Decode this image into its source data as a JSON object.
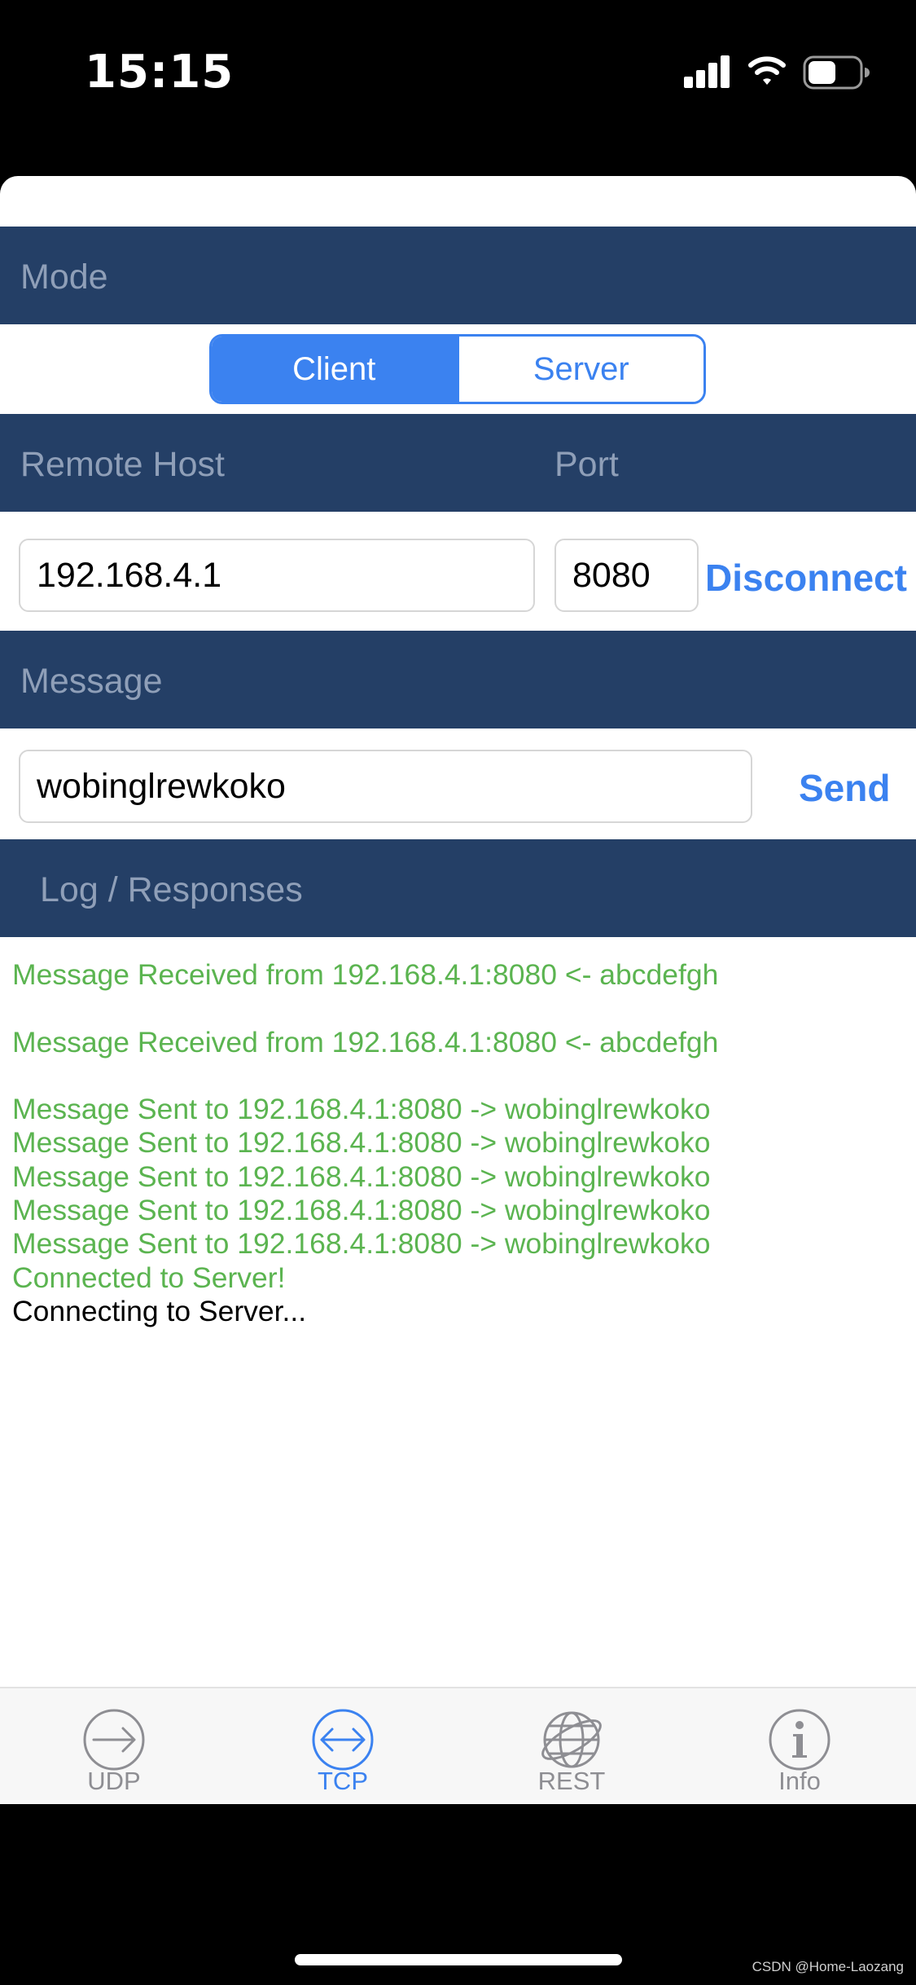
{
  "status_bar": {
    "time": "15:15",
    "battery_level": 0.55
  },
  "mode": {
    "header": "Mode",
    "segments": [
      {
        "label": "Client",
        "selected": true
      },
      {
        "label": "Server",
        "selected": false
      }
    ]
  },
  "connection": {
    "host_header": "Remote Host",
    "port_header": "Port",
    "host_value": "192.168.4.1",
    "port_value": "8080",
    "disconnect_label": "Disconnect"
  },
  "message": {
    "header": "Message",
    "value": "wobinglrewkoko",
    "send_label": "Send"
  },
  "log": {
    "header": "Log / Responses",
    "lines": [
      {
        "text": "Message Received from 192.168.4.1:8080 <- abcdefgh",
        "color": "#5bb450"
      },
      {
        "text": "",
        "color": "#5bb450"
      },
      {
        "text": "Message Received from 192.168.4.1:8080 <- abcdefgh",
        "color": "#5bb450"
      },
      {
        "text": "",
        "color": "#5bb450"
      },
      {
        "text": "Message Sent to 192.168.4.1:8080 -> wobinglrewkoko",
        "color": "#5bb450"
      },
      {
        "text": "Message Sent to 192.168.4.1:8080 -> wobinglrewkoko",
        "color": "#5bb450"
      },
      {
        "text": "Message Sent to 192.168.4.1:8080 -> wobinglrewkoko",
        "color": "#5bb450"
      },
      {
        "text": "Message Sent to 192.168.4.1:8080 -> wobinglrewkoko",
        "color": "#5bb450"
      },
      {
        "text": "Message Sent to 192.168.4.1:8080 -> wobinglrewkoko",
        "color": "#5bb450"
      },
      {
        "text": "Connected to Server!",
        "color": "#5bb450"
      },
      {
        "text": "Connecting to Server...",
        "color": "#000000"
      }
    ]
  },
  "tabs": [
    {
      "label": "UDP",
      "icon": "arrow-right-circle-icon",
      "active": false
    },
    {
      "label": "TCP",
      "icon": "arrows-left-right-circle-icon",
      "active": true
    },
    {
      "label": "REST",
      "icon": "globe-icon",
      "active": false
    },
    {
      "label": "Info",
      "icon": "info-circle-icon",
      "active": false
    }
  ],
  "watermark": "CSDN @Home-Laozang",
  "colors": {
    "band": "#243f66",
    "band_text": "#8f9fb8",
    "accent": "#3b82f0",
    "log_green": "#5bb450",
    "tab_inactive": "#8e8e93"
  }
}
